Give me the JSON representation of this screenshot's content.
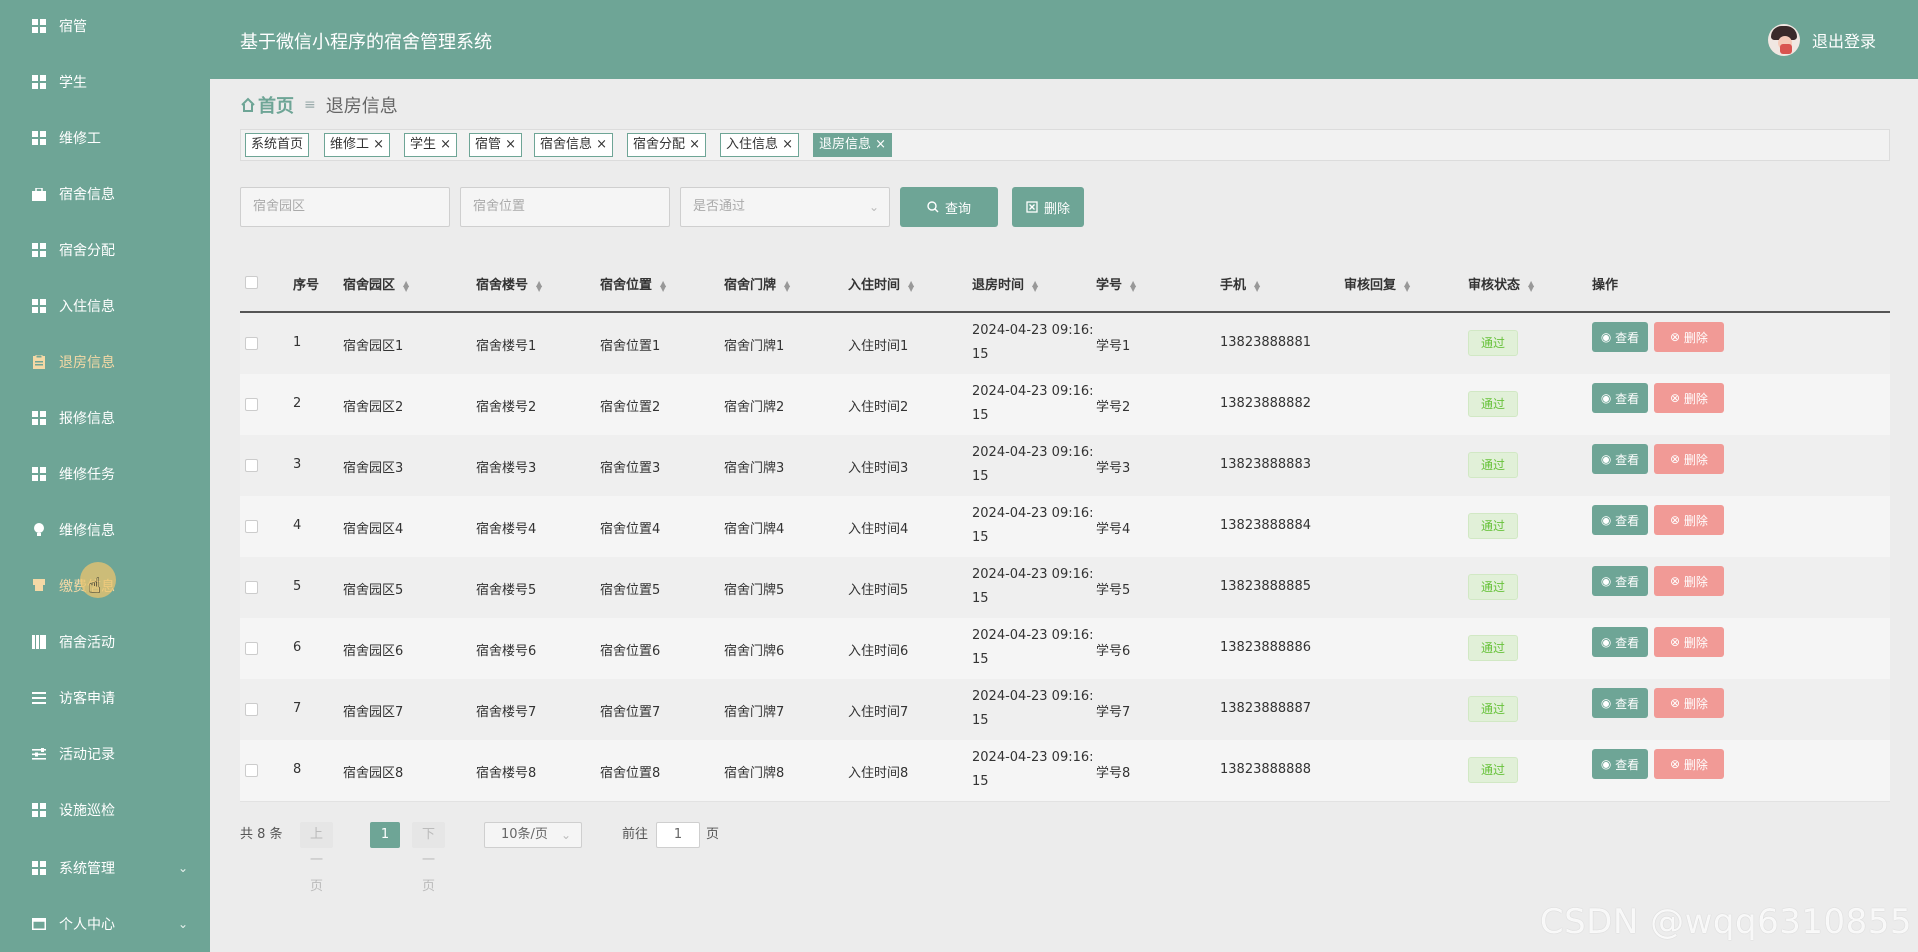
{
  "app": {
    "title": "基于微信小程序的宿舍管理系统",
    "logout": "退出登录"
  },
  "sidebar": {
    "items": [
      {
        "label": "宿管",
        "icon": "grid-icon"
      },
      {
        "label": "学生",
        "icon": "grid-icon"
      },
      {
        "label": "维修工",
        "icon": "grid-icon"
      },
      {
        "label": "宿舍信息",
        "icon": "briefcase-icon"
      },
      {
        "label": "宿舍分配",
        "icon": "grid-icon"
      },
      {
        "label": "入住信息",
        "icon": "grid-icon"
      },
      {
        "label": "退房信息",
        "icon": "clipboard-icon"
      },
      {
        "label": "报修信息",
        "icon": "grid-icon"
      },
      {
        "label": "维修任务",
        "icon": "grid-icon"
      },
      {
        "label": "维修信息",
        "icon": "bulb-icon"
      },
      {
        "label": "缴费信息",
        "icon": "cup-icon"
      },
      {
        "label": "宿舍活动",
        "icon": "bookmark-icon"
      },
      {
        "label": "访客申请",
        "icon": "list-icon"
      },
      {
        "label": "活动记录",
        "icon": "sliders-icon"
      },
      {
        "label": "设施巡检",
        "icon": "grid-icon"
      },
      {
        "label": "系统管理",
        "icon": "grid-icon"
      },
      {
        "label": "个人中心",
        "icon": "window-icon"
      }
    ]
  },
  "breadcrumb": {
    "home": "首页",
    "current": "退房信息"
  },
  "tags": [
    "系统首页",
    "维修工",
    "学生",
    "宿管",
    "宿舍信息",
    "宿舍分配",
    "入住信息",
    "退房信息"
  ],
  "search": {
    "park_placeholder": "宿舍园区",
    "location_placeholder": "宿舍位置",
    "approved_placeholder": "是否通过",
    "query_label": "查询",
    "delete_label": "删除"
  },
  "table": {
    "headers": [
      "序号",
      "宿舍园区",
      "宿舍楼号",
      "宿舍位置",
      "宿舍门牌",
      "入住时间",
      "退房时间",
      "学号",
      "手机",
      "审核回复",
      "审核状态",
      "操作"
    ],
    "rows": [
      {
        "no": "1",
        "park": "宿舍园区1",
        "building": "宿舍楼号1",
        "location": "宿舍位置1",
        "door": "宿舍门牌1",
        "checkin": "入住时间1",
        "checkout_a": "2024-04-23 09:16:",
        "checkout_b": "15",
        "student": "学号1",
        "phone": "13823888881",
        "status": "通过"
      },
      {
        "no": "2",
        "park": "宿舍园区2",
        "building": "宿舍楼号2",
        "location": "宿舍位置2",
        "door": "宿舍门牌2",
        "checkin": "入住时间2",
        "checkout_a": "2024-04-23 09:16:",
        "checkout_b": "15",
        "student": "学号2",
        "phone": "13823888882",
        "status": "通过"
      },
      {
        "no": "3",
        "park": "宿舍园区3",
        "building": "宿舍楼号3",
        "location": "宿舍位置3",
        "door": "宿舍门牌3",
        "checkin": "入住时间3",
        "checkout_a": "2024-04-23 09:16:",
        "checkout_b": "15",
        "student": "学号3",
        "phone": "13823888883",
        "status": "通过"
      },
      {
        "no": "4",
        "park": "宿舍园区4",
        "building": "宿舍楼号4",
        "location": "宿舍位置4",
        "door": "宿舍门牌4",
        "checkin": "入住时间4",
        "checkout_a": "2024-04-23 09:16:",
        "checkout_b": "15",
        "student": "学号4",
        "phone": "13823888884",
        "status": "通过"
      },
      {
        "no": "5",
        "park": "宿舍园区5",
        "building": "宿舍楼号5",
        "location": "宿舍位置5",
        "door": "宿舍门牌5",
        "checkin": "入住时间5",
        "checkout_a": "2024-04-23 09:16:",
        "checkout_b": "15",
        "student": "学号5",
        "phone": "13823888885",
        "status": "通过"
      },
      {
        "no": "6",
        "park": "宿舍园区6",
        "building": "宿舍楼号6",
        "location": "宿舍位置6",
        "door": "宿舍门牌6",
        "checkin": "入住时间6",
        "checkout_a": "2024-04-23 09:16:",
        "checkout_b": "15",
        "student": "学号6",
        "phone": "13823888886",
        "status": "通过"
      },
      {
        "no": "7",
        "park": "宿舍园区7",
        "building": "宿舍楼号7",
        "location": "宿舍位置7",
        "door": "宿舍门牌7",
        "checkin": "入住时间7",
        "checkout_a": "2024-04-23 09:16:",
        "checkout_b": "15",
        "student": "学号7",
        "phone": "13823888887",
        "status": "通过"
      },
      {
        "no": "8",
        "park": "宿舍园区8",
        "building": "宿舍楼号8",
        "location": "宿舍位置8",
        "door": "宿舍门牌8",
        "checkin": "入住时间8",
        "checkout_a": "2024-04-23 09:16:",
        "checkout_b": "15",
        "student": "学号8",
        "phone": "13823888888",
        "status": "通过"
      }
    ],
    "view_label": "查看",
    "delete_label": "删除"
  },
  "pagination": {
    "total": "共 8 条",
    "prev": "上一页",
    "current": "1",
    "next": "下一页",
    "page_size": "10条/页",
    "goto_prefix": "前往",
    "goto_value": "1",
    "goto_suffix": "页"
  },
  "watermark": "CSDN @wqq6310855",
  "colors": {
    "primary": "#6ea596",
    "danger": "#f19a96",
    "success": "#67c23a",
    "active_menu": "#f4d9a6"
  }
}
